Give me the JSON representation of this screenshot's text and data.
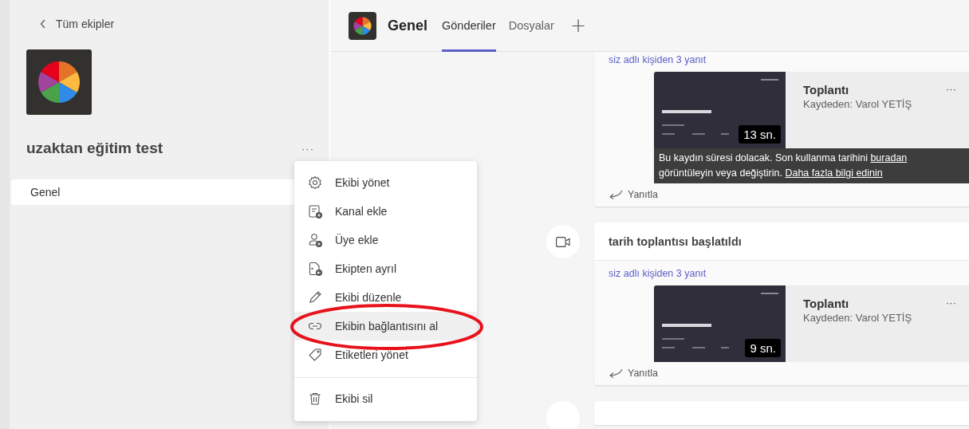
{
  "sidebar": {
    "back_link": "Tüm ekipler",
    "team_name": "uzaktan eğitim test",
    "more": "···",
    "channels": [
      {
        "name": "Genel",
        "selected": true
      }
    ]
  },
  "header": {
    "channel": "Genel",
    "add_tab": "+",
    "tabs": [
      {
        "label": "Gönderiler",
        "selected": true
      },
      {
        "label": "Dosyalar",
        "selected": false
      }
    ]
  },
  "posts": [
    {
      "kind": "top_cut",
      "replies_link": "siz adlı kişiden 3 yanıt",
      "reply": "Yanıtla",
      "recording": {
        "title": "Toplantı",
        "recorded_by": "Kaydeden: Varol YETİŞ",
        "more": "···",
        "duration": "13 sn.",
        "notice": {
          "before": "Bu kaydın süresi dolacak. Son kullanma tarihini ",
          "link": "buradan",
          "middle": " görüntüleyin veya değiştirin. ",
          "link_2": "Daha fazla bilgi edinin"
        }
      }
    },
    {
      "kind": "full",
      "title": "tarih toplantısı başlatıldı",
      "replies_link": "siz adlı kişiden 3 yanıt",
      "reply": "Yanıtla",
      "recording": {
        "title": "Toplantı",
        "recorded_by": "Kaydeden: Varol YETİŞ",
        "more": "···",
        "duration": "9 sn."
      }
    },
    {
      "kind": "bottom_cut"
    }
  ],
  "context_menu": {
    "groups": [
      [
        {
          "kind": "gear",
          "label": "Ekibi yönet",
          "selected": false
        },
        {
          "kind": "channel_add",
          "label": "Kanal ekle",
          "selected": false
        },
        {
          "kind": "person_add",
          "label": "Üye ekle",
          "selected": false
        },
        {
          "kind": "leave",
          "label": "Ekipten ayrıl",
          "selected": false
        },
        {
          "kind": "pencil",
          "label": "Ekibi düzenle",
          "selected": false
        },
        {
          "kind": "link",
          "label": "Ekibin bağlantısını al",
          "selected": true
        },
        {
          "kind": "tag",
          "label": "Etiketleri yönet",
          "selected": false
        }
      ],
      [
        {
          "kind": "trash",
          "label": "Ekibi sil",
          "selected": false
        }
      ]
    ]
  },
  "annotation": {
    "kind": "ellipse"
  }
}
